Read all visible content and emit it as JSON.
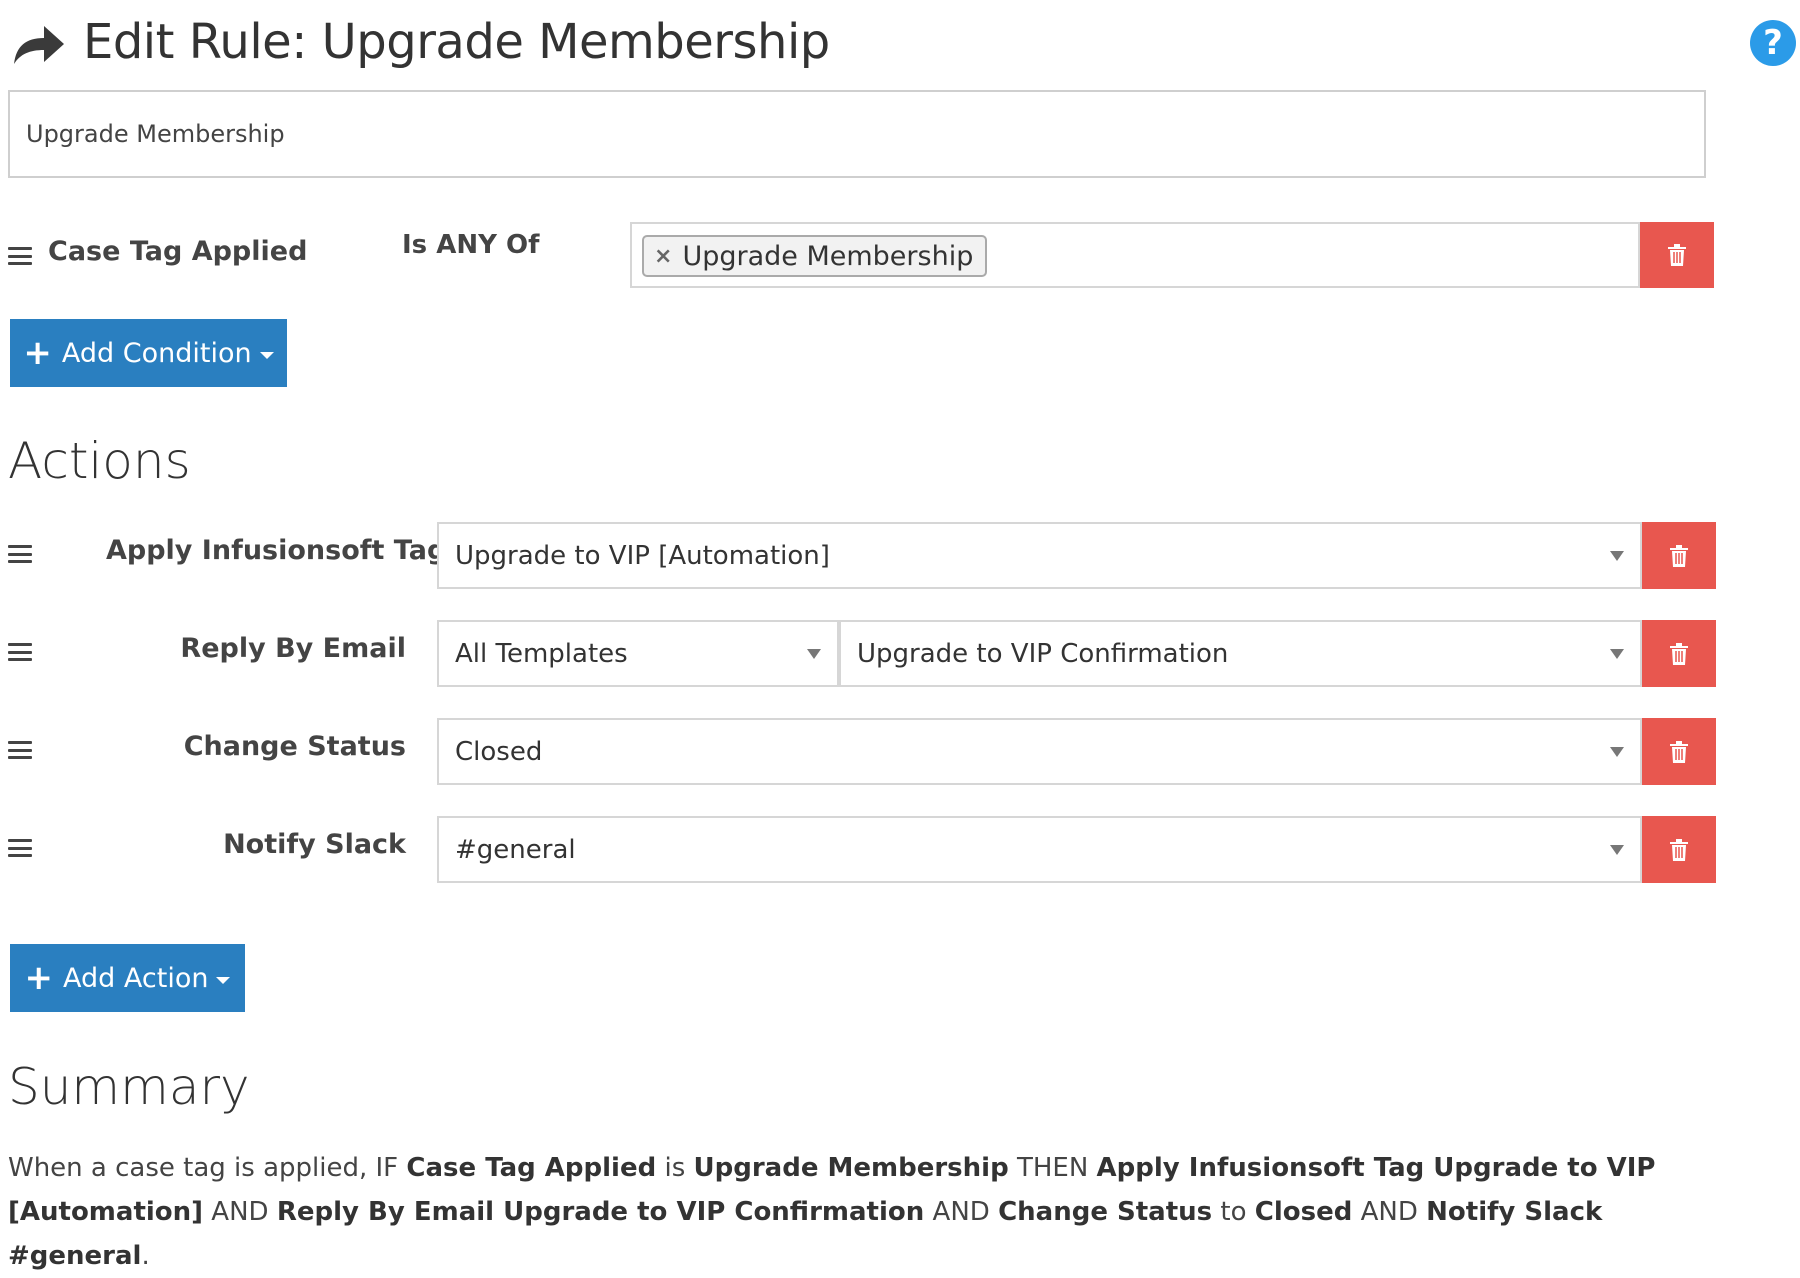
{
  "header": {
    "title": "Edit Rule: Upgrade Membership",
    "help_label": "?"
  },
  "rule_name": {
    "value": "Upgrade Membership"
  },
  "condition": {
    "field": "Case Tag Applied",
    "operator": "Is ANY Of",
    "tags": [
      "Upgrade Membership"
    ],
    "remove_glyph": "×"
  },
  "add_condition": {
    "label": "Add Condition"
  },
  "actions_heading": "Actions",
  "actions": [
    {
      "label": "Apply Infusionsoft Tag",
      "value": "Upgrade to VIP [Automation]"
    },
    {
      "label": "Reply By Email",
      "value": "All Templates",
      "value2": "Upgrade to VIP Confirmation"
    },
    {
      "label": "Change Status",
      "value": "Closed"
    },
    {
      "label": "Notify Slack",
      "value": "#general"
    }
  ],
  "add_action": {
    "label": "Add Action"
  },
  "summary_heading": "Summary",
  "summary": {
    "t1": "When a case tag is applied, IF ",
    "b1": "Case Tag Applied",
    "t2": " is ",
    "b2": "Upgrade Membership",
    "t3": " THEN ",
    "b3": "Apply Infusionsoft Tag Upgrade to VIP [Automation]",
    "t4": " AND ",
    "b4": "Reply By Email Upgrade to VIP Confirmation",
    "t5": " AND ",
    "b5": "Change Status",
    "t6": " to ",
    "b6": "Closed",
    "t7": " AND ",
    "b7": "Notify Slack #general",
    "t8": "."
  },
  "colors": {
    "primary": "#2a7fc0",
    "danger": "#e8574f",
    "help": "#2b9be8"
  },
  "icons": {
    "header": "share-arrow-icon",
    "drag": "drag-handle-icon",
    "delete": "trash-icon",
    "help": "question-circle-icon",
    "add": "plus-icon",
    "dropdown": "caret-down-icon"
  }
}
